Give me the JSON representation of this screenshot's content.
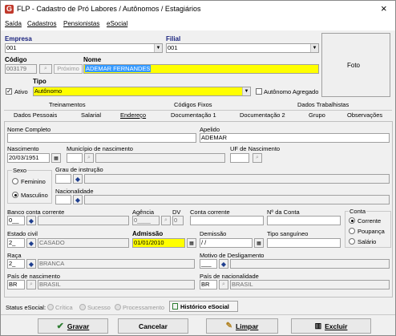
{
  "window": {
    "title": "FLP - Cadastro de Pró Labores / Autônomos / Estagiários",
    "close_glyph": "×"
  },
  "menu": [
    "Saída",
    "Cadastros",
    "Pensionistas",
    "eSocial"
  ],
  "header": {
    "empresa_label": "Empresa",
    "empresa_value": "001",
    "filial_label": "Filial",
    "filial_value": "001",
    "codigo_label": "Código",
    "codigo_value": "003179",
    "proximo_label": "Próximo",
    "nome_label": "Nome",
    "nome_value": "ADEMAR FERNANDES",
    "ativo_label": "Ativo",
    "tipo_label": "Tipo",
    "tipo_value": "Autônomo",
    "autonomo_agregado_label": "Autônomo Agregado",
    "foto_label": "Foto"
  },
  "tabs_top": [
    "Treinamentos",
    "Códigos Fixos",
    "Dados Trabalhistas"
  ],
  "tabs_bottom": [
    "Dados Pessoais",
    "Salarial",
    "Endereço",
    "Documentação 1",
    "Documentação 2",
    "Grupo",
    "Observações"
  ],
  "form": {
    "nome_completo_label": "Nome Completo",
    "nome_completo_value": "",
    "apelido_label": "Apelido",
    "apelido_value": "ADEMAR",
    "nascimento_label": "Nascimento",
    "nascimento_value": "20/03/1951",
    "municipio_label": "Município de nascimento",
    "uf_label": "UF de Nascimento",
    "sexo_label": "Sexo",
    "feminino_label": "Feminino",
    "masculino_label": "Masculino",
    "grau_label": "Grau de instrução",
    "nacionalidade_label": "Nacionalidade",
    "banco_label": "Banco conta corrente",
    "banco_value": "0__",
    "agencia_label": "Agência",
    "agencia_value": "0____",
    "dv_label": "DV",
    "dv_value": "0",
    "conta_corrente_label": "Conta corrente",
    "n_conta_label": "Nº da Conta",
    "conta_label": "Conta",
    "corrente_label": "Corrente",
    "poupanca_label": "Poupança",
    "salario_label": "Salário",
    "estado_civil_label": "Estado civil",
    "estado_civil_code": "2_",
    "estado_civil_value": "CASADO",
    "admissao_label": "Admissão",
    "admissao_value": "01/01/2010",
    "demissao_label": "Demissão",
    "demissao_value": " / /",
    "tipo_sanguineo_label": "Tipo sanguíneo",
    "raca_label": "Raça",
    "raca_code": "2_",
    "raca_value": "BRANCA",
    "motivo_label": "Motivo de Desligamento",
    "motivo_value": "___",
    "pais_nasc_label": "País de nascimento",
    "pais_nasc_code": "BR",
    "pais_nasc_value": "BRASIL",
    "pais_nac_label": "País de nacionalidade",
    "pais_nac_code": "BR",
    "pais_nac_value": "BRASIL"
  },
  "status": {
    "label": "Status eSocial:",
    "critica": "Crítica",
    "sucesso": "Sucesso",
    "processamento": "Processamento",
    "historico": "Histórico eSocial"
  },
  "buttons": {
    "gravar": "Gravar",
    "cancelar": "Cancelar",
    "limpar": "Limpar",
    "excluir": "Excluir"
  },
  "colors": {
    "yellow": "#ffff00",
    "selection": "#3399ff",
    "lookup_icon": "#1f3f8f",
    "brand_red": "#c0392b"
  }
}
